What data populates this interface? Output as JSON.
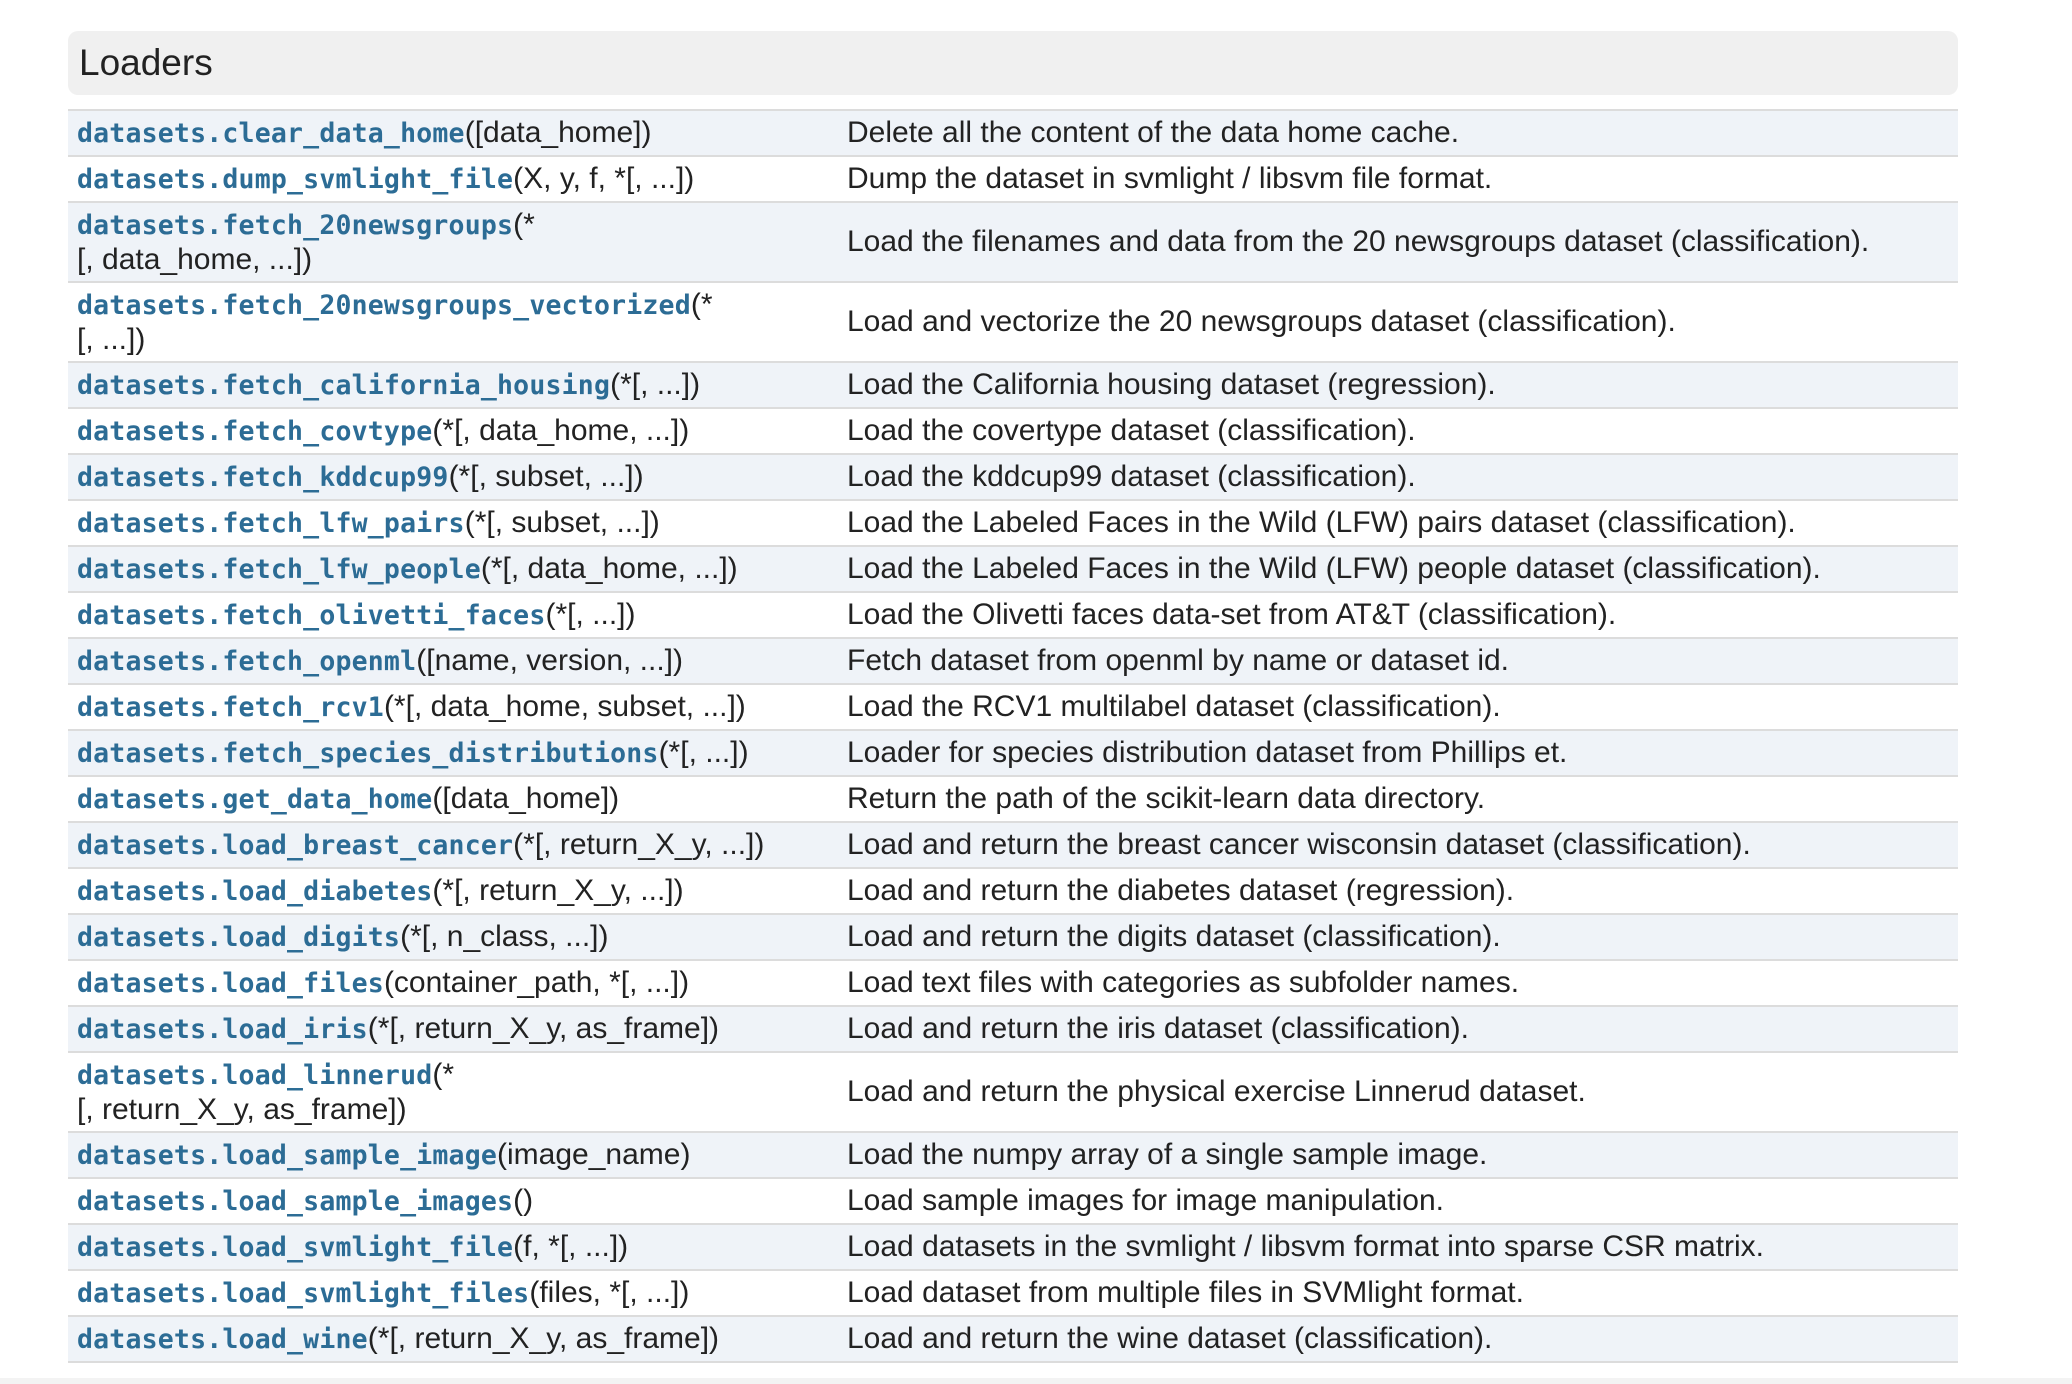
{
  "section": {
    "title": "Loaders"
  },
  "rows": [
    {
      "name": "datasets.clear_data_home",
      "args": "([data_home])",
      "args_line2": "",
      "desc": "Delete all the content of the data home cache."
    },
    {
      "name": "datasets.dump_svmlight_file",
      "args": "(X, y, f, *[, ...])",
      "args_line2": "",
      "desc": "Dump the dataset in svmlight / libsvm file format."
    },
    {
      "name": "datasets.fetch_20newsgroups",
      "args": "(*",
      "args_line2": "[, data_home, ...])",
      "desc": "Load the filenames and data from the 20 newsgroups dataset (classification)."
    },
    {
      "name": "datasets.fetch_20newsgroups_vectorized",
      "args": "(*",
      "args_line2": "[, ...])",
      "desc": "Load and vectorize the 20 newsgroups dataset (classification)."
    },
    {
      "name": "datasets.fetch_california_housing",
      "args": "(*[, ...])",
      "args_line2": "",
      "desc": "Load the California housing dataset (regression)."
    },
    {
      "name": "datasets.fetch_covtype",
      "args": "(*[, data_home, ...])",
      "args_line2": "",
      "desc": "Load the covertype dataset (classification)."
    },
    {
      "name": "datasets.fetch_kddcup99",
      "args": "(*[, subset, ...])",
      "args_line2": "",
      "desc": "Load the kddcup99 dataset (classification)."
    },
    {
      "name": "datasets.fetch_lfw_pairs",
      "args": "(*[, subset, ...])",
      "args_line2": "",
      "desc": "Load the Labeled Faces in the Wild (LFW) pairs dataset (classification)."
    },
    {
      "name": "datasets.fetch_lfw_people",
      "args": "(*[, data_home, ...])",
      "args_line2": "",
      "desc": "Load the Labeled Faces in the Wild (LFW) people dataset (classification)."
    },
    {
      "name": "datasets.fetch_olivetti_faces",
      "args": "(*[, ...])",
      "args_line2": "",
      "desc": "Load the Olivetti faces data-set from AT&T (classification)."
    },
    {
      "name": "datasets.fetch_openml",
      "args": "([name, version, ...])",
      "args_line2": "",
      "desc": "Fetch dataset from openml by name or dataset id."
    },
    {
      "name": "datasets.fetch_rcv1",
      "args": "(*[, data_home, subset, ...])",
      "args_line2": "",
      "desc": "Load the RCV1 multilabel dataset (classification)."
    },
    {
      "name": "datasets.fetch_species_distributions",
      "args": "(*[, ...])",
      "args_line2": "",
      "desc": "Loader for species distribution dataset from Phillips et."
    },
    {
      "name": "datasets.get_data_home",
      "args": "([data_home])",
      "args_line2": "",
      "desc": "Return the path of the scikit-learn data directory."
    },
    {
      "name": "datasets.load_breast_cancer",
      "args": "(*[, return_X_y, ...])",
      "args_line2": "",
      "desc": "Load and return the breast cancer wisconsin dataset (classification)."
    },
    {
      "name": "datasets.load_diabetes",
      "args": "(*[, return_X_y, ...])",
      "args_line2": "",
      "desc": "Load and return the diabetes dataset (regression)."
    },
    {
      "name": "datasets.load_digits",
      "args": "(*[, n_class, ...])",
      "args_line2": "",
      "desc": "Load and return the digits dataset (classification)."
    },
    {
      "name": "datasets.load_files",
      "args": "(container_path, *[, ...])",
      "args_line2": "",
      "desc": "Load text files with categories as subfolder names."
    },
    {
      "name": "datasets.load_iris",
      "args": "(*[, return_X_y, as_frame])",
      "args_line2": "",
      "desc": "Load and return the iris dataset (classification)."
    },
    {
      "name": "datasets.load_linnerud",
      "args": "(*",
      "args_line2": "[, return_X_y, as_frame])",
      "desc": "Load and return the physical exercise Linnerud dataset."
    },
    {
      "name": "datasets.load_sample_image",
      "args": "(image_name)",
      "args_line2": "",
      "desc": "Load the numpy array of a single sample image."
    },
    {
      "name": "datasets.load_sample_images",
      "args": "()",
      "args_line2": "",
      "desc": "Load sample images for image manipulation."
    },
    {
      "name": "datasets.load_svmlight_file",
      "args": "(f, *[, ...])",
      "args_line2": "",
      "desc": "Load datasets in the svmlight / libsvm format into sparse CSR matrix."
    },
    {
      "name": "datasets.load_svmlight_files",
      "args": "(files, *[, ...])",
      "args_line2": "",
      "desc": "Load dataset from multiple files in SVMlight format."
    },
    {
      "name": "datasets.load_wine",
      "args": "(*[, return_X_y, as_frame])",
      "args_line2": "",
      "desc": "Load and return the wine dataset (classification)."
    }
  ],
  "colors": {
    "link": "#2c6c95",
    "row_alt": "#eff3f8",
    "header_bg": "#f0f0f0",
    "border": "#dcdcdc"
  }
}
